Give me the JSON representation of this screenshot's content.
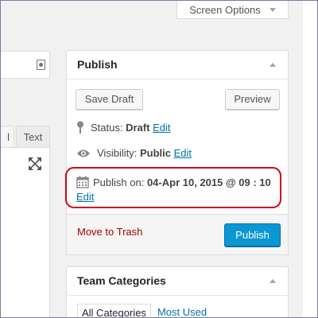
{
  "screen_options": {
    "label": "Screen Options"
  },
  "editor": {
    "visual_tab_label": "l",
    "text_tab_label": "Text"
  },
  "publish": {
    "title": "Publish",
    "save_draft_label": "Save Draft",
    "preview_label": "Preview",
    "status": {
      "label": "Status:",
      "value": "Draft",
      "edit": "Edit",
      "icon": "pin-icon"
    },
    "visibility": {
      "label": "Visibility:",
      "value": "Public",
      "edit": "Edit",
      "icon": "eye-icon"
    },
    "publish_on": {
      "label": "Publish on:",
      "value": "04-Apr 10, 2015 @ 09 : 10",
      "edit": "Edit",
      "icon": "calendar-icon"
    },
    "trash_label": "Move to Trash",
    "publish_button_label": "Publish"
  },
  "team_categories": {
    "title": "Team Categories",
    "tabs": [
      "All Categories",
      "Most Used"
    ]
  },
  "colors": {
    "accent": "#0073aa",
    "publish_button": "#0a97d3",
    "trash": "#aa0000",
    "highlight": "#d0021b"
  }
}
